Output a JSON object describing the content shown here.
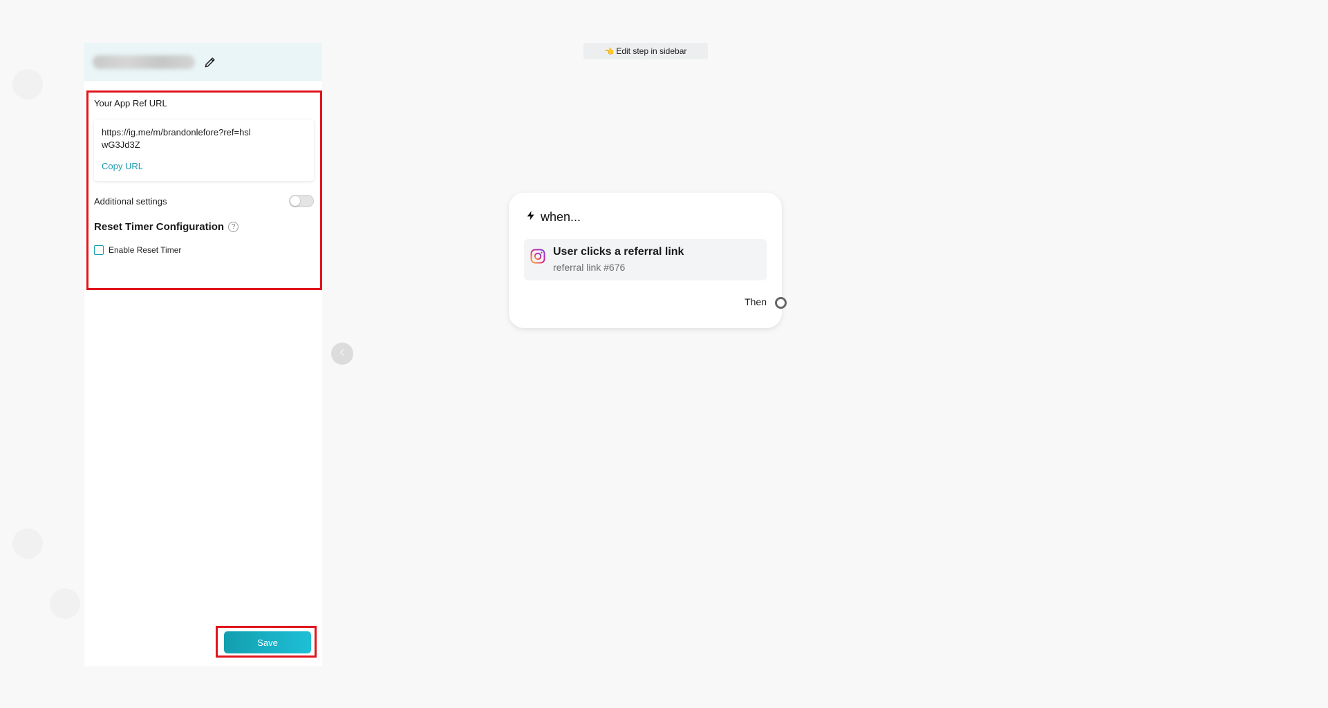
{
  "sidebar": {
    "ref_url_label": "Your App Ref URL",
    "ref_url_value": "https://ig.me/m/brandonlefore?ref=hslwG3Jd3Z",
    "copy_url_label": "Copy URL",
    "additional_settings_label": "Additional settings",
    "additional_settings_enabled": false,
    "reset_timer_title": "Reset Timer Configuration",
    "help_glyph": "?",
    "enable_reset_timer_label": "Enable Reset Timer",
    "enable_reset_timer_checked": false,
    "save_label": "Save"
  },
  "canvas": {
    "hint_icon": "👈",
    "hint_text": "Edit step in sidebar",
    "node": {
      "title": "when...",
      "trigger_title": "User clicks a referral link",
      "trigger_subtitle": "referral link #676",
      "then_label": "Then"
    }
  },
  "colors": {
    "accent": "#1a9bb0",
    "highlight_border": "#e0141b",
    "sidebar_header_bg": "#eaf5f7"
  },
  "icons": {
    "edit": "pencil-icon",
    "collapse": "chevron-left-icon",
    "trigger": "lightning-icon",
    "platform": "instagram-icon",
    "help": "help-icon"
  }
}
